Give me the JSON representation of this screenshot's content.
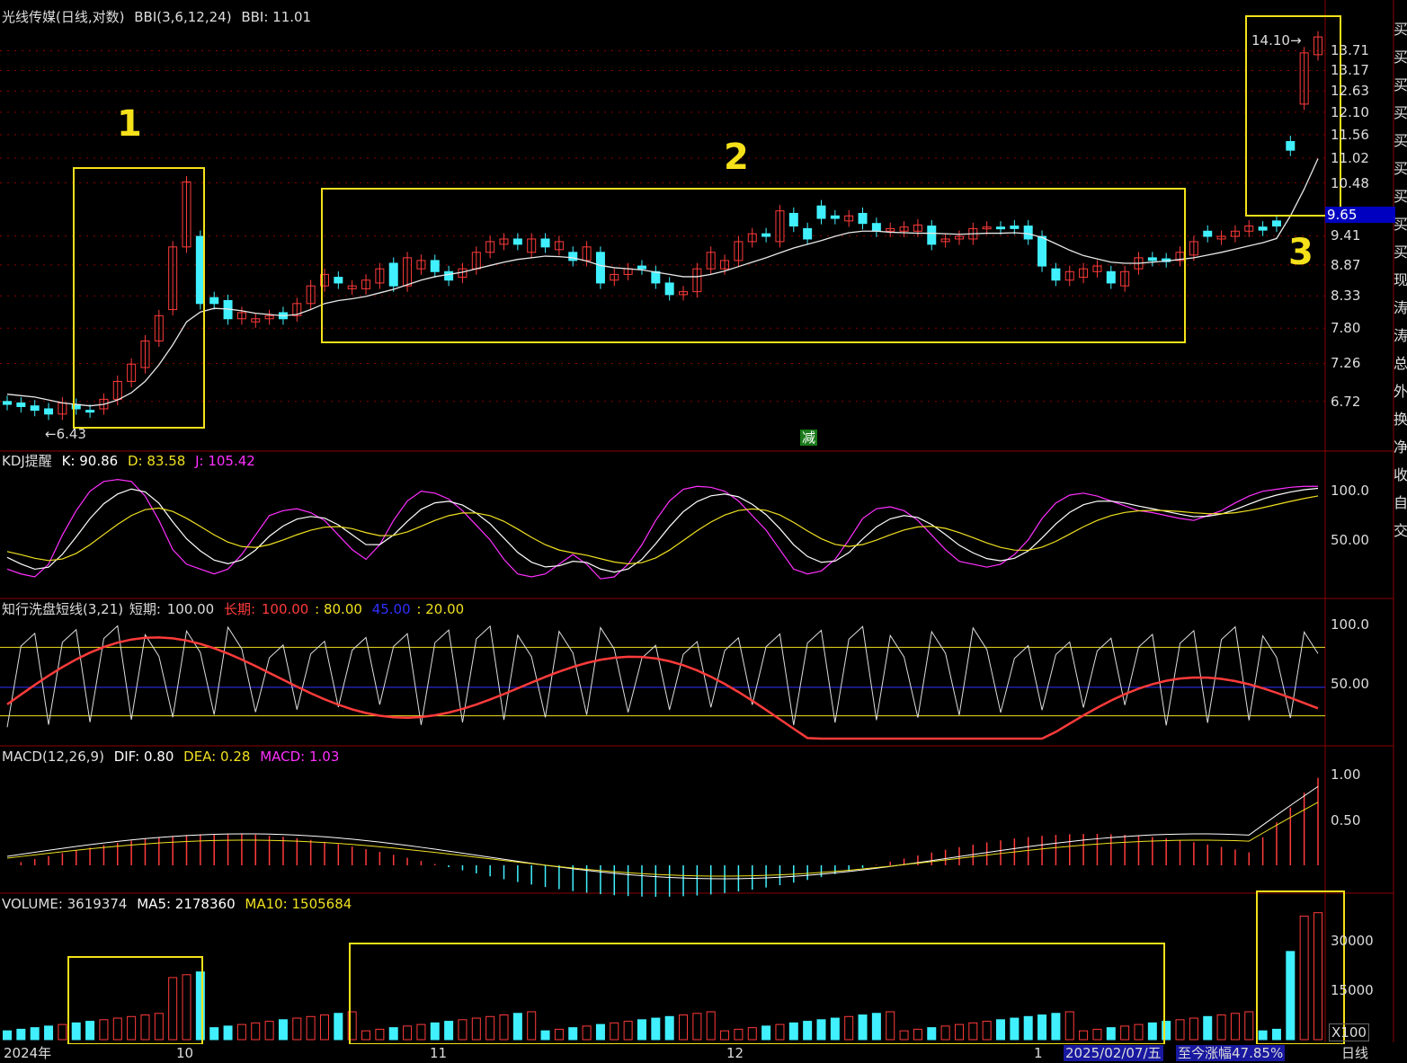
{
  "colors": {
    "up": "#ff3b3b",
    "down": "#40f0ff",
    "ma": "#e8e8e8",
    "yellow": "#f0e020",
    "magenta": "#ff30ff",
    "blue": "#3030ff",
    "grid": "#8b0000",
    "box": "#f5e11a"
  },
  "main_panel": {
    "title": "光线传媒(日线,对数)",
    "indicator": "BBI(3,6,12,24)",
    "indicator_value": "BBI: 11.01",
    "price_ticks": [
      "13.71",
      "13.17",
      "12.63",
      "12.10",
      "11.56",
      "11.02",
      "10.48",
      "9.41",
      "8.87",
      "8.33",
      "7.80",
      "7.26",
      "6.72"
    ],
    "current_price": "9.65",
    "low_marker": "6.43",
    "high_marker": "14.10",
    "signal_label": "减"
  },
  "kdj_panel": {
    "name": "KDJ提醒",
    "k": "K: 90.86",
    "d": "D: 83.58",
    "j": "J: 105.42",
    "ticks": [
      "100.0",
      "50.00"
    ]
  },
  "wash_panel": {
    "name": "知行洗盘短线(3,21)",
    "short_label": "短期:",
    "short_value": "100.00",
    "long_label": "长期:",
    "long_value": "100.00",
    "level1": ": 80.00",
    "level2": "45.00",
    "level3": ": 20.00",
    "ticks": [
      "100.0",
      "50.00"
    ]
  },
  "macd_panel": {
    "name": "MACD(12,26,9)",
    "dif": "DIF: 0.80",
    "dea": "DEA: 0.28",
    "macd": "MACD: 1.03",
    "ticks": [
      "1.00",
      "0.50"
    ]
  },
  "volume_panel": {
    "name": "VOLUME: 3619374",
    "ma5": "MA5: 2178360",
    "ma10": "MA10: 1505684",
    "ticks": [
      "30000",
      "15000"
    ],
    "unit": "X100"
  },
  "time_axis": {
    "year": "2024年",
    "months": [
      "10",
      "11",
      "12",
      "1"
    ],
    "cursor_date": "2025/02/07/五",
    "gain": "至今涨幅47.85%",
    "period": "日线"
  },
  "annotations": [
    "1",
    "2",
    "3"
  ],
  "right_sidebar": [
    "买",
    "买",
    "买",
    "买",
    "买",
    "买",
    "买",
    "买",
    "买",
    "现",
    "涛",
    "涛",
    "总",
    "外",
    "换",
    "净",
    "收",
    "自",
    "交"
  ],
  "chart_data": {
    "type": "candlestick",
    "title": "光线传媒(日线,对数)",
    "candles": [
      {
        "o": 6.72,
        "c": 6.68
      },
      {
        "o": 6.7,
        "c": 6.65
      },
      {
        "o": 6.66,
        "c": 6.6
      },
      {
        "o": 6.62,
        "c": 6.55
      },
      {
        "o": 6.55,
        "c": 6.7
      },
      {
        "o": 6.68,
        "c": 6.62
      },
      {
        "o": 6.6,
        "c": 6.58
      },
      {
        "o": 6.62,
        "c": 6.75
      },
      {
        "o": 6.75,
        "c": 7.0
      },
      {
        "o": 7.0,
        "c": 7.25
      },
      {
        "o": 7.2,
        "c": 7.6
      },
      {
        "o": 7.6,
        "c": 8.0
      },
      {
        "o": 8.1,
        "c": 9.2
      },
      {
        "o": 9.2,
        "c": 10.5
      },
      {
        "o": 9.4,
        "c": 8.2
      },
      {
        "o": 8.3,
        "c": 8.2
      },
      {
        "o": 8.25,
        "c": 7.95
      },
      {
        "o": 7.95,
        "c": 8.05
      },
      {
        "o": 7.9,
        "c": 7.95
      },
      {
        "o": 7.95,
        "c": 8.0
      },
      {
        "o": 8.05,
        "c": 7.95
      },
      {
        "o": 8.0,
        "c": 8.2
      },
      {
        "o": 8.2,
        "c": 8.5
      },
      {
        "o": 8.5,
        "c": 8.7
      },
      {
        "o": 8.65,
        "c": 8.55
      },
      {
        "o": 8.45,
        "c": 8.5
      },
      {
        "o": 8.45,
        "c": 8.6
      },
      {
        "o": 8.55,
        "c": 8.8
      },
      {
        "o": 8.9,
        "c": 8.5
      },
      {
        "o": 8.5,
        "c": 9.0
      },
      {
        "o": 8.8,
        "c": 8.95
      },
      {
        "o": 8.95,
        "c": 8.75
      },
      {
        "o": 8.75,
        "c": 8.6
      },
      {
        "o": 8.65,
        "c": 8.8
      },
      {
        "o": 8.8,
        "c": 9.1
      },
      {
        "o": 9.1,
        "c": 9.3
      },
      {
        "o": 9.25,
        "c": 9.35
      },
      {
        "o": 9.35,
        "c": 9.25
      },
      {
        "o": 9.1,
        "c": 9.35
      },
      {
        "o": 9.35,
        "c": 9.2
      },
      {
        "o": 9.15,
        "c": 9.3
      },
      {
        "o": 9.1,
        "c": 8.95
      },
      {
        "o": 8.95,
        "c": 9.2
      },
      {
        "o": 9.1,
        "c": 8.55
      },
      {
        "o": 8.6,
        "c": 8.7
      },
      {
        "o": 8.7,
        "c": 8.8
      },
      {
        "o": 8.85,
        "c": 8.8
      },
      {
        "o": 8.75,
        "c": 8.55
      },
      {
        "o": 8.55,
        "c": 8.35
      },
      {
        "o": 8.35,
        "c": 8.4
      },
      {
        "o": 8.4,
        "c": 8.8
      },
      {
        "o": 8.8,
        "c": 9.1
      },
      {
        "o": 8.8,
        "c": 8.95
      },
      {
        "o": 8.95,
        "c": 9.3
      },
      {
        "o": 9.3,
        "c": 9.45
      },
      {
        "o": 9.45,
        "c": 9.4
      },
      {
        "o": 9.3,
        "c": 9.9
      },
      {
        "o": 9.85,
        "c": 9.6
      },
      {
        "o": 9.55,
        "c": 9.35
      },
      {
        "o": 10.0,
        "c": 9.75
      },
      {
        "o": 9.8,
        "c": 9.75
      },
      {
        "o": 9.7,
        "c": 9.8
      },
      {
        "o": 9.85,
        "c": 9.65
      },
      {
        "o": 9.65,
        "c": 9.5
      },
      {
        "o": 9.5,
        "c": 9.55
      },
      {
        "o": 9.5,
        "c": 9.58
      },
      {
        "o": 9.5,
        "c": 9.62
      },
      {
        "o": 9.6,
        "c": 9.25
      },
      {
        "o": 9.3,
        "c": 9.35
      },
      {
        "o": 9.35,
        "c": 9.4
      },
      {
        "o": 9.35,
        "c": 9.55
      },
      {
        "o": 9.55,
        "c": 9.58
      },
      {
        "o": 9.58,
        "c": 9.55
      },
      {
        "o": 9.6,
        "c": 9.55
      },
      {
        "o": 9.6,
        "c": 9.35
      },
      {
        "o": 9.4,
        "c": 8.85
      },
      {
        "o": 8.8,
        "c": 8.6
      },
      {
        "o": 8.6,
        "c": 8.75
      },
      {
        "o": 8.65,
        "c": 8.8
      },
      {
        "o": 8.75,
        "c": 8.85
      },
      {
        "o": 8.75,
        "c": 8.55
      },
      {
        "o": 8.5,
        "c": 8.75
      },
      {
        "o": 8.8,
        "c": 9.0
      },
      {
        "o": 9.0,
        "c": 8.95
      },
      {
        "o": 8.98,
        "c": 8.93
      },
      {
        "o": 8.95,
        "c": 9.1
      },
      {
        "o": 9.05,
        "c": 9.3
      },
      {
        "o": 9.5,
        "c": 9.4
      },
      {
        "o": 9.35,
        "c": 9.4
      },
      {
        "o": 9.4,
        "c": 9.5
      },
      {
        "o": 9.5,
        "c": 9.6
      },
      {
        "o": 9.58,
        "c": 9.52
      },
      {
        "o": 9.7,
        "c": 9.6
      },
      {
        "o": 11.4,
        "c": 11.2
      },
      {
        "o": 12.3,
        "c": 13.65
      },
      {
        "o": 13.6,
        "c": 14.1
      }
    ],
    "bbi": [
      6.82,
      6.8,
      6.78,
      6.74,
      6.7,
      6.68,
      6.66,
      6.68,
      6.74,
      6.84,
      7.0,
      7.24,
      7.54,
      7.9,
      8.06,
      8.12,
      8.11,
      8.08,
      8.04,
      8.02,
      8.0,
      8.02,
      8.1,
      8.2,
      8.25,
      8.28,
      8.32,
      8.38,
      8.44,
      8.52,
      8.6,
      8.66,
      8.7,
      8.74,
      8.8,
      8.86,
      8.92,
      8.97,
      9.0,
      9.03,
      9.02,
      9.0,
      8.94,
      8.86,
      8.82,
      8.8,
      8.78,
      8.74,
      8.7,
      8.66,
      8.66,
      8.7,
      8.76,
      8.84,
      8.92,
      9.0,
      9.09,
      9.18,
      9.25,
      9.32,
      9.4,
      9.47,
      9.5,
      9.5,
      9.48,
      9.47,
      9.46,
      9.46,
      9.45,
      9.44,
      9.45,
      9.46,
      9.46,
      9.47,
      9.45,
      9.38,
      9.26,
      9.14,
      9.04,
      8.98,
      8.92,
      8.9,
      8.9,
      8.92,
      8.94,
      8.97,
      9.0,
      9.05,
      9.1,
      9.16,
      9.22,
      9.28,
      9.36,
      9.8,
      10.35,
      11.01
    ]
  }
}
